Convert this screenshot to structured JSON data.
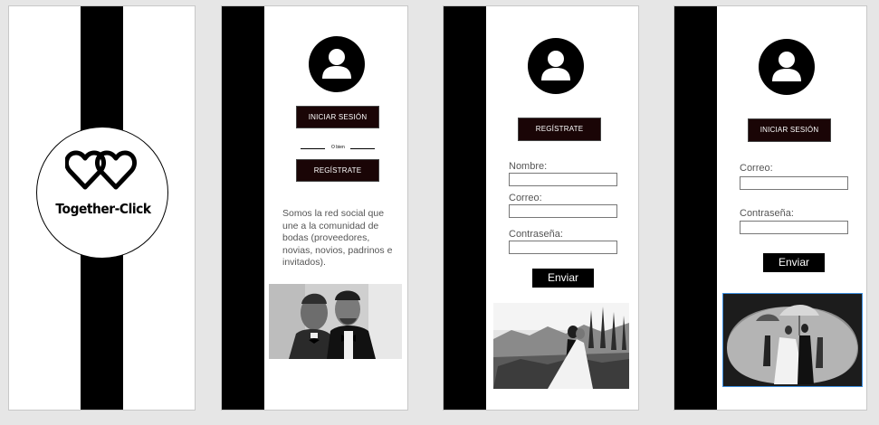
{
  "splash": {
    "app_name": "Together-Click"
  },
  "home": {
    "login_label": "INICIAR SESIÓN",
    "or_text": "O bien",
    "register_label": "REGÍSTRATE",
    "description": "Somos la red social que une a la comunidad de bodas (proveedores, novias, novios, padrinos e invitados)."
  },
  "register": {
    "title_button": "REGÍSTRATE",
    "name_label": "Nombre:",
    "email_label": "Correo:",
    "password_label": "Contraseña:",
    "send_label": "Enviar"
  },
  "login": {
    "title_button": "INICIAR SESIÓN",
    "email_label": "Correo:",
    "password_label": "Contraseña:",
    "send_label": "Enviar"
  },
  "colors": {
    "stripe": "#000000",
    "button_bg": "#1a0506",
    "selection": "#3d8fe0"
  },
  "icons": [
    "interlocked-hearts-logo",
    "user-avatar-icon"
  ]
}
